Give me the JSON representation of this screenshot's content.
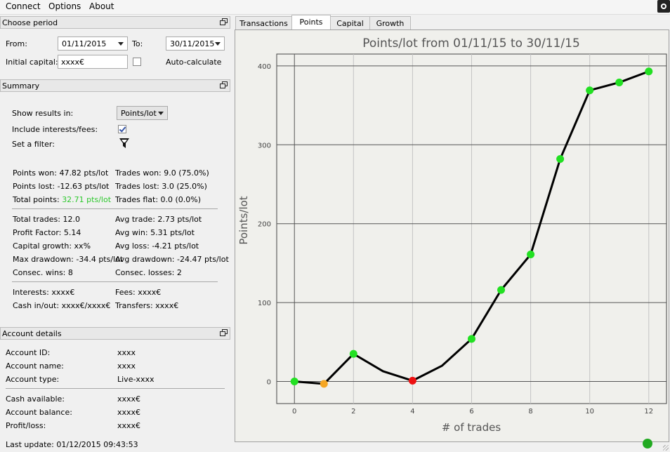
{
  "menu": {
    "connect": "Connect",
    "options": "Options",
    "about": "About"
  },
  "period": {
    "header": "Choose period",
    "from_label": "From:",
    "from_value": "01/11/2015",
    "to_label": "To:",
    "to_value": "30/11/2015",
    "capital_label": "Initial capital:",
    "capital_value": "xxxx€",
    "autocalc_label": "Auto-calculate",
    "autocalc_checked": false
  },
  "summary": {
    "header": "Summary",
    "show_results_label": "Show results in:",
    "show_results_value": "Points/lot",
    "include_label": "Include interests/fees:",
    "include_checked": true,
    "filter_label": "Set a filter:",
    "points_won": "Points won: 47.82 pts/lot",
    "points_lost": "Points lost: -12.63 pts/lot",
    "total_points_label": "Total points: ",
    "total_points_value": "32.71 pts/lot",
    "trades_won": "Trades won: 9.0 (75.0%)",
    "trades_lost": "Trades lost: 3.0 (25.0%)",
    "trades_flat": "Trades flat: 0.0 (0.0%)",
    "total_trades": "Total trades: 12.0",
    "profit_factor": "Profit Factor: 5.14",
    "capital_growth": "Capital growth: xx%",
    "max_drawdown": "Max drawdown: -34.4 pts/lot",
    "consec_wins": "Consec. wins: 8",
    "avg_trade": "Avg trade: 2.73 pts/lot",
    "avg_win": "Avg win: 5.31 pts/lot",
    "avg_loss": "Avg loss: -4.21 pts/lot",
    "avg_drawdown": "Avg drawdown: -24.47 pts/lot",
    "consec_losses": "Consec. losses: 2",
    "interests": "Interests: xxxx€",
    "fees": "Fees: xxxx€",
    "cash_inout": "Cash in/out: xxxx€/xxxx€",
    "transfers": "Transfers: xxxx€"
  },
  "account": {
    "header": "Account details",
    "id_label": "Account ID:",
    "id_value": "xxxx",
    "name_label": "Account name:",
    "name_value": "xxxx",
    "type_label": "Account type:",
    "type_value": "Live-xxxx",
    "cash_label": "Cash available:",
    "cash_value": "xxxx€",
    "balance_label": "Account balance:",
    "balance_value": "xxxx€",
    "pl_label": "Profit/loss:",
    "pl_value": "xxxx€"
  },
  "tabs": [
    "Transactions",
    "Points",
    "Capital",
    "Growth"
  ],
  "active_tab": "Points",
  "status": {
    "last_update": "Last update: 01/12/2015 09:43:53",
    "connection_color": "#22aa22"
  },
  "chart_data": {
    "type": "line",
    "title": "Points/lot from 01/11/15 to 30/11/15",
    "xlabel": "# of trades",
    "ylabel": "Points/lot",
    "xlim": [
      -0.6,
      12.6
    ],
    "ylim": [
      -28,
      415
    ],
    "xticks": [
      0,
      2,
      4,
      6,
      8,
      10,
      12
    ],
    "yticks": [
      0,
      100,
      200,
      300,
      400
    ],
    "grid": true,
    "points": [
      {
        "x": 0,
        "y": 0,
        "color": "#22e022"
      },
      {
        "x": 1,
        "y": -3,
        "color": "#f5a623"
      },
      {
        "x": 2,
        "y": 35,
        "color": "#22e022"
      },
      {
        "x": 3,
        "y": 13,
        "color": null
      },
      {
        "x": 4,
        "y": 1,
        "color": "#ee1111"
      },
      {
        "x": 5,
        "y": 20,
        "color": null
      },
      {
        "x": 6,
        "y": 54,
        "color": "#22e022"
      },
      {
        "x": 7,
        "y": 116,
        "color": "#22e022"
      },
      {
        "x": 8,
        "y": 161,
        "color": "#22e022"
      },
      {
        "x": 9,
        "y": 282,
        "color": "#22e022"
      },
      {
        "x": 10,
        "y": 369,
        "color": "#22e022"
      },
      {
        "x": 11,
        "y": 379,
        "color": "#22e022"
      },
      {
        "x": 12,
        "y": 393,
        "color": "#22e022"
      }
    ],
    "line_color": "#000000"
  }
}
